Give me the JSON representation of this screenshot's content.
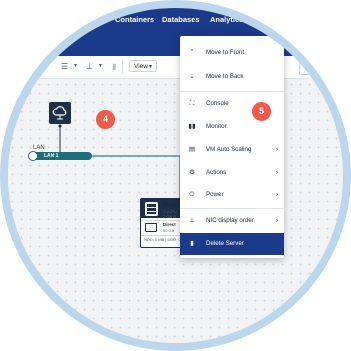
{
  "nav": {
    "items": [
      "Containers",
      "Databases",
      "Analytics"
    ]
  },
  "toolbar": {
    "view_label": "View"
  },
  "callouts": {
    "badge_left": "4",
    "badge_menu": "5"
  },
  "canvas": {
    "lan_label": "LAN",
    "lan_bar_label": "LAN 1",
    "server": {
      "name": "Cube",
      "sub1": "1 vCPU",
      "sub2": "2 GB R",
      "disk_name": "Direct",
      "disk_size": "50 GB",
      "footer": "NDD: 0 MB | DDD: 0"
    }
  },
  "context_menu": {
    "items": [
      {
        "icon": "chevron-up-icon",
        "label": "Move to Front"
      },
      {
        "icon": "chevron-down-icon",
        "label": "Move to Back"
      },
      {
        "icon": "console-icon",
        "label": "Console"
      },
      {
        "icon": "monitor-icon",
        "label": "Monitor"
      },
      {
        "icon": "scaling-icon",
        "label": "VM Auto Scaling"
      },
      {
        "icon": "gear-icon",
        "label": "Actions"
      },
      {
        "icon": "power-icon",
        "label": "Power"
      },
      {
        "icon": "nic-icon",
        "label": "NIC display order"
      },
      {
        "icon": "trash-icon",
        "label": "Delete Server"
      }
    ]
  },
  "colors": {
    "nav_bg": "#1b3a8a",
    "badge": "#f15a4a",
    "menu_active": "#1b3a8a",
    "lan_teal": "#1e6f77",
    "node_dark": "#1d2f49"
  }
}
